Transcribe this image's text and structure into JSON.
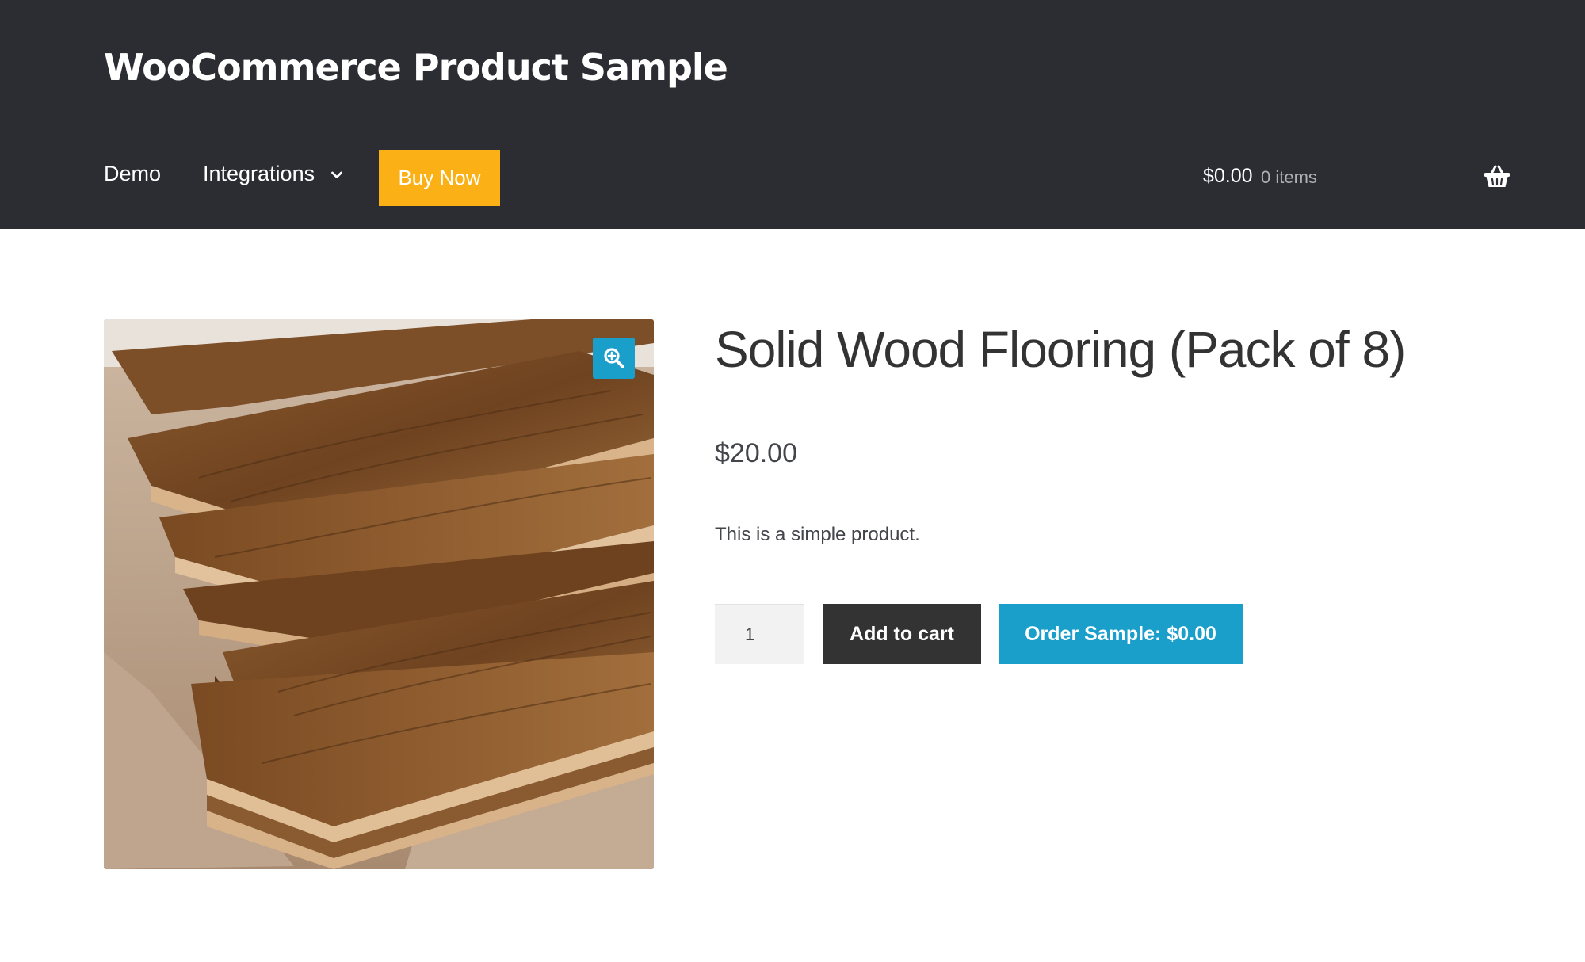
{
  "header": {
    "site_title": "WooCommerce Product Sample",
    "nav": {
      "demo": "Demo",
      "integrations": "Integrations",
      "buy_now": "Buy Now"
    },
    "cart": {
      "amount": "$0.00",
      "count": "0 items"
    }
  },
  "product": {
    "title": "Solid Wood Flooring (Pack of 8)",
    "price": "$20.00",
    "description": "This is a simple product.",
    "quantity": "1",
    "add_to_cart_label": "Add to cart",
    "order_sample_label": "Order Sample: $0.00"
  },
  "icons": {
    "chevron": "chevron-down-icon",
    "basket": "basket-icon",
    "zoom": "zoom-icon"
  },
  "colors": {
    "header_bg": "#2c2d33",
    "buy_now": "#fbb116",
    "accent_blue": "#1a9fcb",
    "dark_button": "#333333"
  }
}
